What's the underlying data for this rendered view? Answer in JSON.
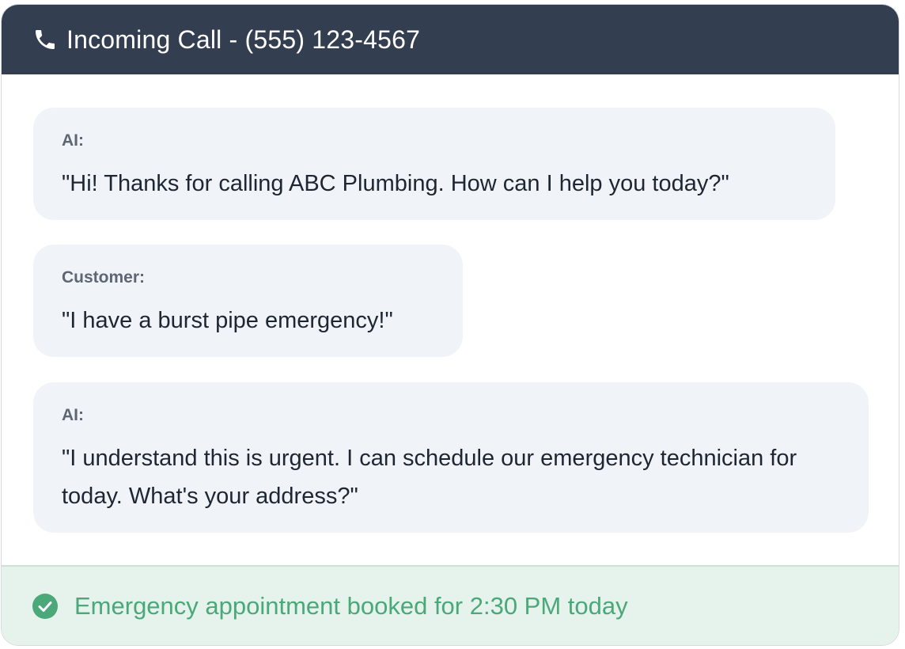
{
  "header": {
    "icon": "phone-icon",
    "title": "Incoming Call - (555) 123-4567"
  },
  "messages": [
    {
      "speaker": "AI:",
      "text": "\"Hi! Thanks for calling ABC Plumbing. How can I help you today?\""
    },
    {
      "speaker": "Customer:",
      "text": "\"I have a burst pipe emergency!\""
    },
    {
      "speaker": "AI:",
      "text": "\"I understand this is urgent. I can schedule our emergency technician for today. What's your address?\""
    }
  ],
  "status": {
    "icon": "check-circle-icon",
    "text": "Emergency appointment booked for 2:30 PM today",
    "color": "#4aa879"
  },
  "colors": {
    "header_bg": "#343e51",
    "bubble_bg": "#f0f3f7",
    "footer_bg": "#e5f3ec"
  }
}
